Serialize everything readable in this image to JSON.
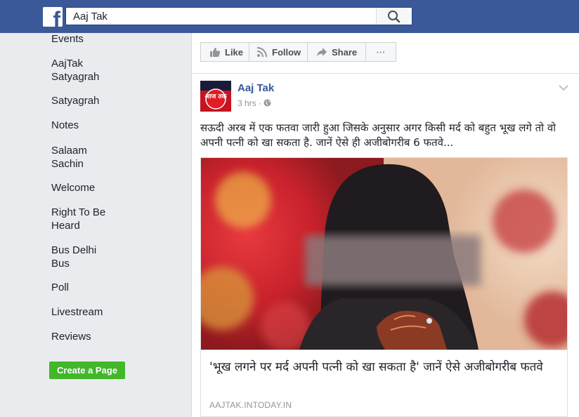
{
  "header": {
    "logo": "f",
    "search_value": "Aaj Tak",
    "icons": [
      "facebook-logo-icon",
      "search-icon"
    ],
    "brand_color": "#3b5998"
  },
  "sidebar": {
    "items": [
      {
        "label": "Events"
      },
      {
        "label": "AajTak\nSatyagrah"
      },
      {
        "label": "Satyagrah"
      },
      {
        "label": "Notes"
      },
      {
        "label": "Salaam\nSachin"
      },
      {
        "label": "Welcome"
      },
      {
        "label": "Right To Be\nHeard"
      },
      {
        "label": "Bus Delhi\nBus"
      },
      {
        "label": "Poll"
      },
      {
        "label": "Livestream"
      },
      {
        "label": "Reviews"
      }
    ],
    "create_page_label": "Create a Page",
    "create_color": "#42b72a"
  },
  "actions": {
    "like": "Like",
    "follow": "Follow",
    "share": "Share",
    "more": "···"
  },
  "post": {
    "page_name": "Aaj Tak",
    "avatar_text": "आज तक",
    "time": "3 hrs · ",
    "privacy_icon": "globe-icon",
    "text": "सऊदी अरब में एक फतवा जारी हुआ जिसके अनुसार अगर किसी मर्द को बहुत भूख लगे तो वो अपनी पत्नी को खा सकता है. जानें ऐसे ही अजीबोगरीब 6 फतवे...",
    "link": {
      "title": "'भूख लगने पर मर्द अपनी पत्नी को खा सकता है' जानें ऐसे अजीबोगरीब फतवे",
      "domain": "AAJTAK.INTODAY.IN"
    }
  }
}
